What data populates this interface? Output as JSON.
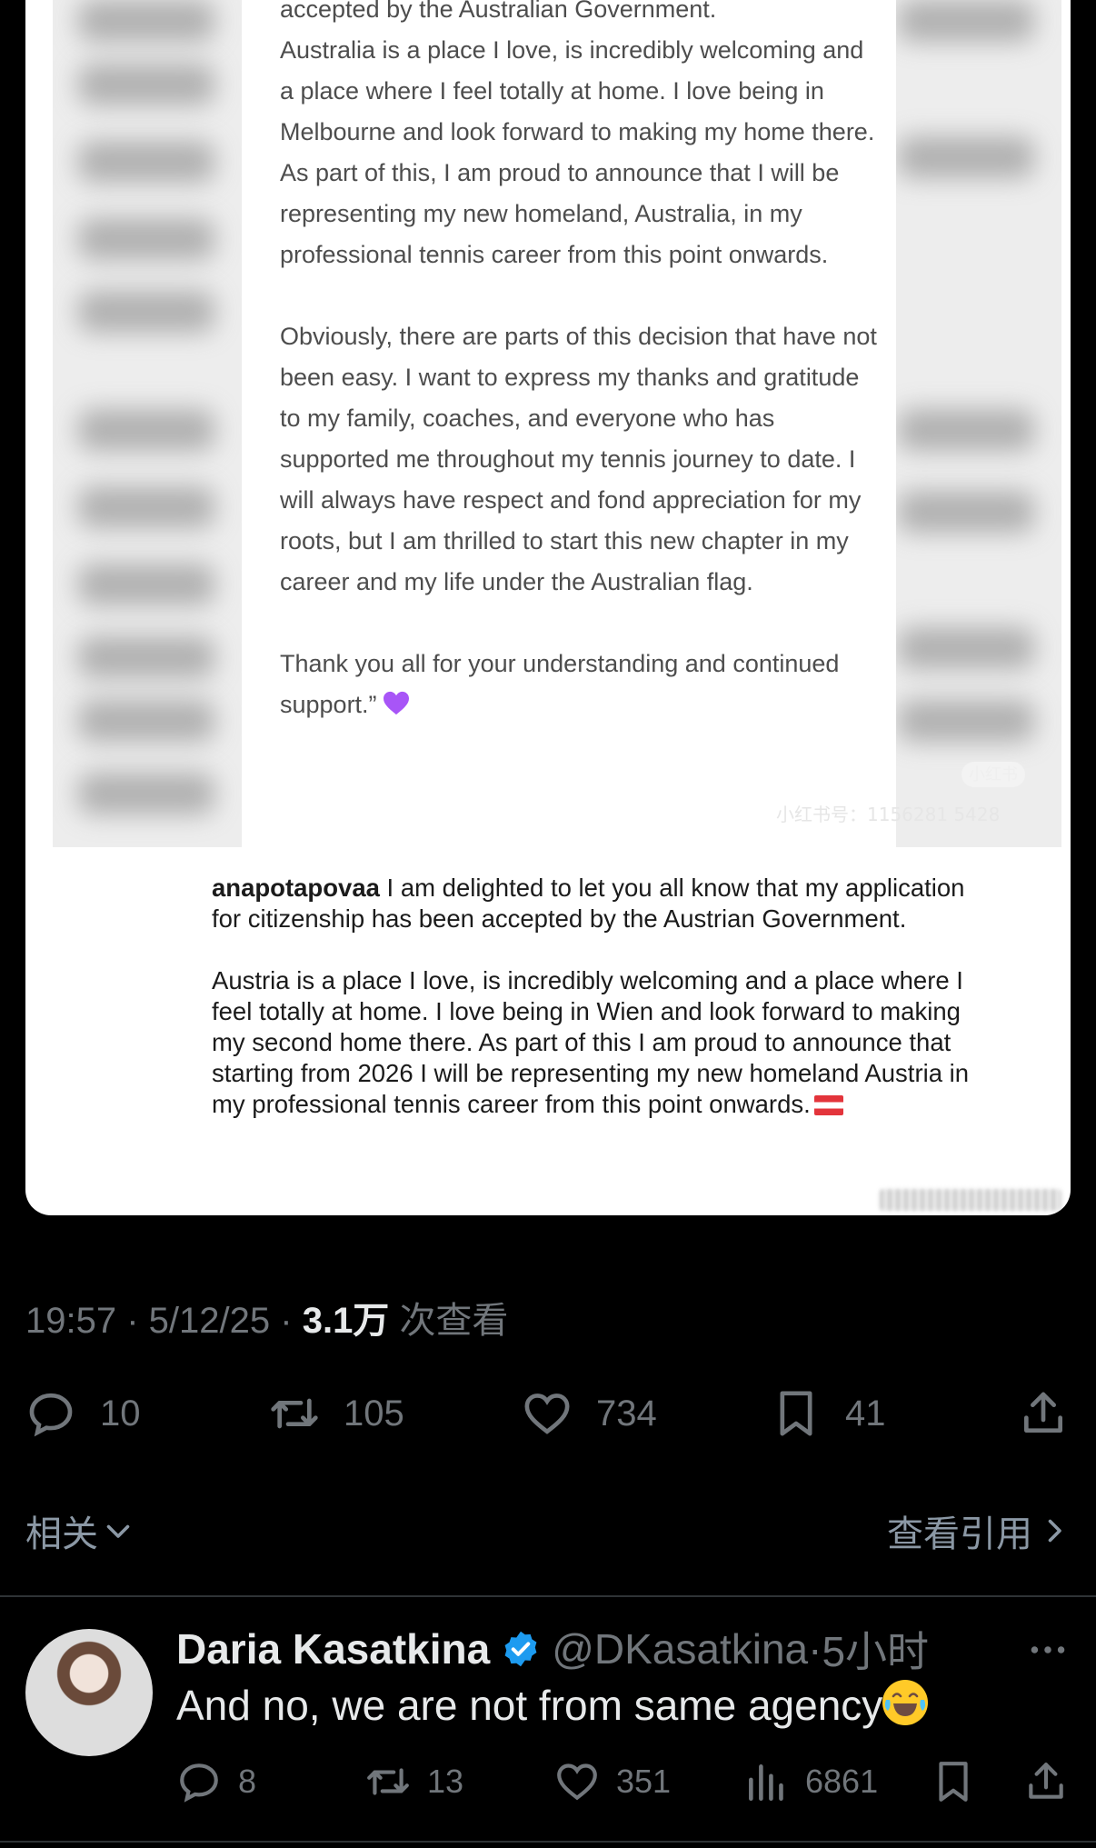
{
  "note": {
    "paragraphs": [
      "accepted by the Australian Government.\nAustralia is a place I love,  is incredibly welcoming and a place where I feel totally at home. I love being in Melbourne and look forward to making my home there. As part of this, I am proud to announce that I will be representing my new homeland, Australia, in my professional tennis career from this point onwards.",
      "Obviously, there are parts of this decision that have not been easy. I want to express my thanks and gratitude to my family, coaches, and everyone who has supported me throughout my tennis journey to date. I will always have respect and fond appreciation for my roots, but I am thrilled to start this new chapter in my career and my life under the Australian flag.",
      "Thank you all for your understanding and continued support.”"
    ],
    "watermark_badge": "小红书",
    "watermark_id": "小红书号：1156281 5428"
  },
  "instagram": {
    "username": "anapotapovaa",
    "caption_1": " I am delighted to let you all know that my application for citizenship has been accepted by the Austrian Government.",
    "caption_2": "Austria is a place I love, is incredibly welcoming and a place where I feel totally at home. I love being in Wien and look forward to making my second home there. As part of this I am proud to announce that starting from 2026 I will be representing my new homeland Austria in my professional tennis career from this point onwards."
  },
  "tweet_meta": {
    "time": "19:57",
    "date": "5/12/25",
    "views_count": "3.1万",
    "views_label": "次查看"
  },
  "tweet_actions": {
    "replies": "10",
    "retweets": "105",
    "likes": "734",
    "bookmarks": "41"
  },
  "related_label": "相关",
  "quotes_label": "查看引用",
  "reply": {
    "name": "Daria Kasatkina",
    "handle": "@DKasatkina",
    "time": "5小时",
    "text": "And no, we are not from same agency",
    "replies": "8",
    "retweets": "13",
    "likes": "351",
    "views": "6861"
  },
  "colors": {
    "background": "#000000",
    "muted": "#71767b",
    "verified": "#1d9bf0",
    "heart_emoji": "#a855f7"
  },
  "icons": [
    "reply-icon",
    "retweet-icon",
    "like-icon",
    "bookmark-icon",
    "share-icon",
    "chevron-down-icon",
    "chevron-right-icon",
    "verified-badge-icon",
    "more-icon",
    "views-icon",
    "purple-heart-icon",
    "laughing-emoji-icon",
    "austria-flag-icon"
  ]
}
